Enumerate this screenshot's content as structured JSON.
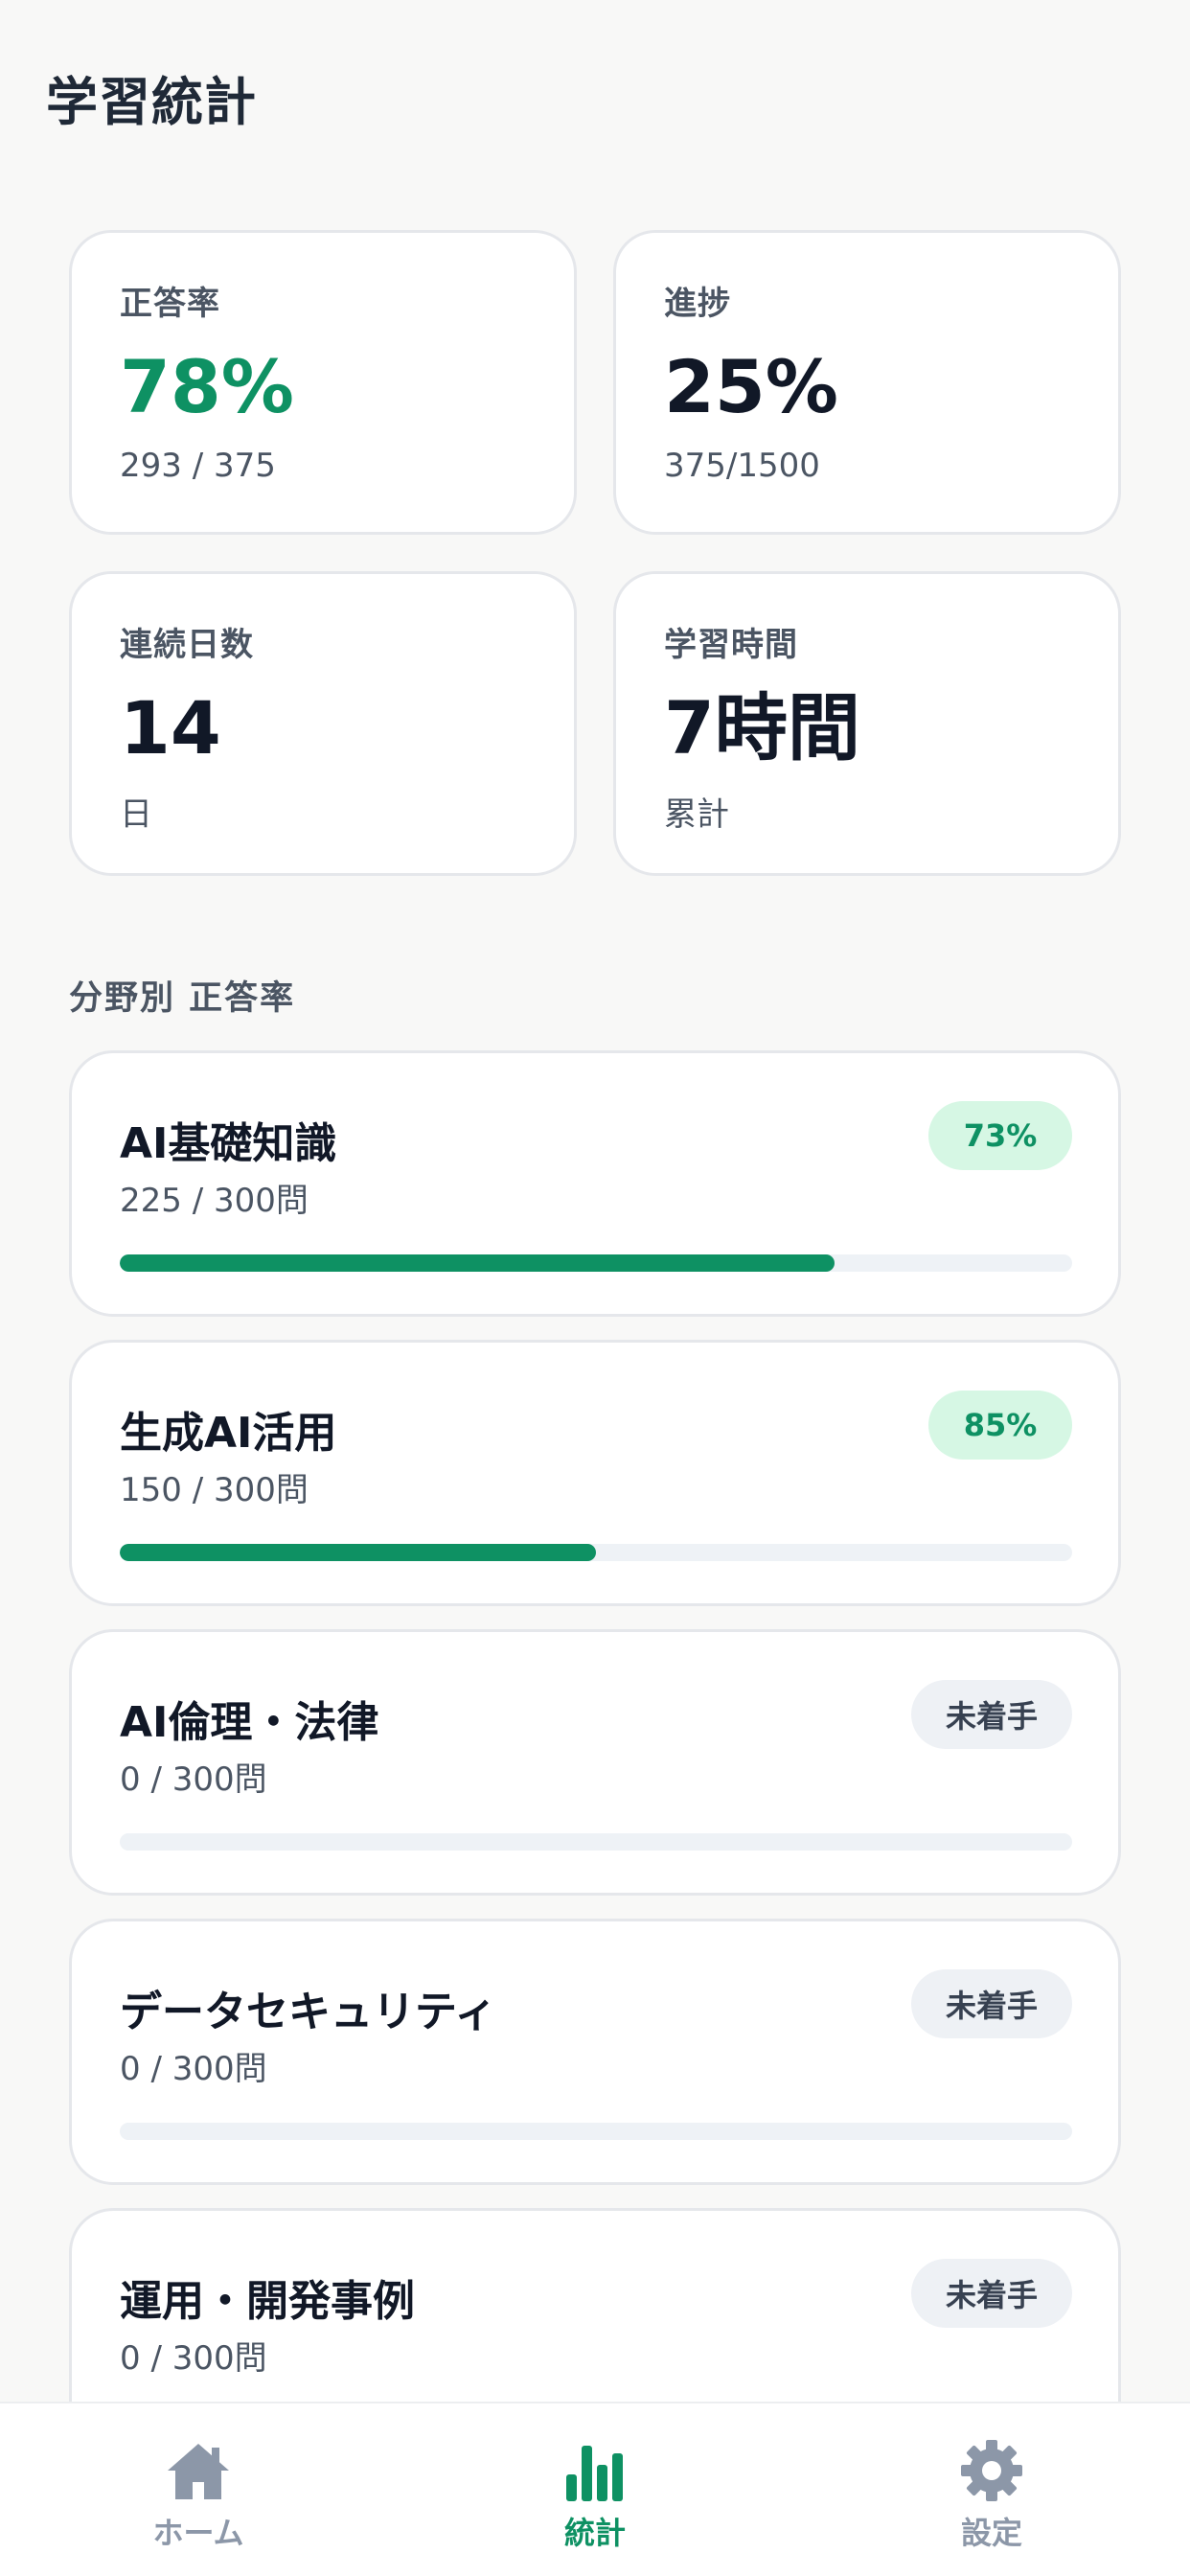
{
  "header": {
    "title": "学習統計"
  },
  "stats": [
    {
      "label": "正答率",
      "value": "78%",
      "sub": "293 / 375",
      "accent": true
    },
    {
      "label": "進捗",
      "value": "25%",
      "sub": "375/1500",
      "accent": false
    },
    {
      "label": "連続日数",
      "value": "14",
      "sub": "日",
      "accent": false
    },
    {
      "label": "学習時間",
      "value": "7時間",
      "sub": "累計",
      "accent": false
    }
  ],
  "section": {
    "title": "分野別 正答率"
  },
  "categories": [
    {
      "name": "AI基礎知識",
      "count": "225 / 300問",
      "badge": "73%",
      "status": "done",
      "progress": 0.75
    },
    {
      "name": "生成AI活用",
      "count": "150 / 300問",
      "badge": "85%",
      "status": "done",
      "progress": 0.5
    },
    {
      "name": "AI倫理・法律",
      "count": "0 / 300問",
      "badge": "未着手",
      "status": "none",
      "progress": 0
    },
    {
      "name": "データセキュリティ",
      "count": "0 / 300問",
      "badge": "未着手",
      "status": "none",
      "progress": 0
    },
    {
      "name": "運用・開発事例",
      "count": "0 / 300問",
      "badge": "未着手",
      "status": "none",
      "progress": 0
    }
  ],
  "nav": {
    "items": [
      {
        "label": "ホーム",
        "icon": "home-icon",
        "active": false
      },
      {
        "label": "統計",
        "icon": "bar-chart-icon",
        "active": true
      },
      {
        "label": "設定",
        "icon": "gear-icon",
        "active": false
      }
    ]
  },
  "colors": {
    "accent": "#0e9163",
    "inactive": "#8c97a8"
  }
}
